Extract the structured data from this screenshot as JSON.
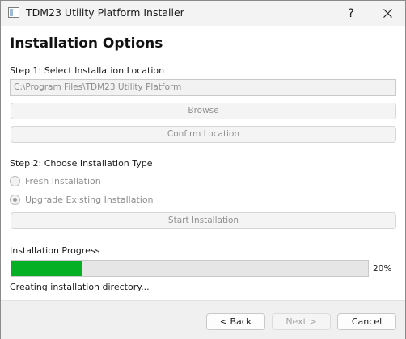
{
  "window": {
    "title": "TDM23 Utility Platform Installer",
    "help_label": "?",
    "close_icon": "close-icon"
  },
  "page": {
    "heading": "Installation Options"
  },
  "step1": {
    "label": "Step 1: Select Installation Location",
    "path_value": "C:\\Program Files\\TDM23 Utility Platform",
    "browse_label": "Browse",
    "confirm_label": "Confirm Location"
  },
  "step2": {
    "label": "Step 2: Choose Installation Type",
    "options": [
      {
        "label": "Fresh Installation",
        "checked": false
      },
      {
        "label": "Upgrade Existing Installation",
        "checked": true
      }
    ],
    "start_label": "Start Installation"
  },
  "progress": {
    "label": "Installation Progress",
    "value": 20,
    "percent_text": "20%",
    "status": "Creating installation directory...",
    "fill_color": "#06b025"
  },
  "footer": {
    "back_label": "< Back",
    "next_label": "Next >",
    "cancel_label": "Cancel"
  }
}
